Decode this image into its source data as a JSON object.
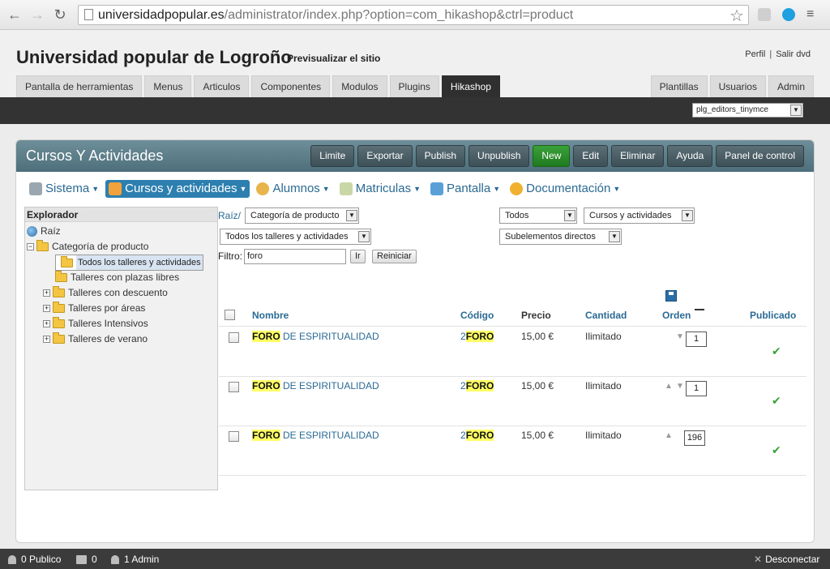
{
  "browser": {
    "url_host": "universidadpopular.es",
    "url_path": "/administrator/index.php?option=com_hikashop&ctrl=product"
  },
  "header": {
    "site_title": "Universidad popular de Logroño",
    "preview_link": "Previsualizar el sitio",
    "profile_link": "Perfil",
    "separator": "|",
    "logout_link": "Salir dvd"
  },
  "main_tabs": [
    {
      "label": "Pantalla de herramientas"
    },
    {
      "label": "Menus"
    },
    {
      "label": "Articulos"
    },
    {
      "label": "Componentes"
    },
    {
      "label": "Modulos"
    },
    {
      "label": "Plugins"
    },
    {
      "label": "Hikashop",
      "active": true
    }
  ],
  "right_tabs": [
    {
      "label": "Plantillas"
    },
    {
      "label": "Usuarios"
    },
    {
      "label": "Admin"
    }
  ],
  "editor_select": "plg_editors_tinymce",
  "panel": {
    "title": "Cursos Y Actividades",
    "toolbar": {
      "limite": "Limite",
      "exportar": "Exportar",
      "publish": "Publish",
      "unpublish": "Unpublish",
      "new": "New",
      "edit": "Edit",
      "eliminar": "Eliminar",
      "ayuda": "Ayuda",
      "panel_control": "Panel de control"
    }
  },
  "submenu": [
    {
      "label": "Sistema",
      "icon": "tools-icon"
    },
    {
      "label": "Cursos y actividades",
      "icon": "box-icon",
      "active": true
    },
    {
      "label": "Alumnos",
      "icon": "users-icon"
    },
    {
      "label": "Matriculas",
      "icon": "document-icon"
    },
    {
      "label": "Pantalla",
      "icon": "palette-icon"
    },
    {
      "label": "Documentación",
      "icon": "help-icon"
    }
  ],
  "explorer": {
    "title": "Explorador",
    "root": "Raíz",
    "category": "Categoría de producto",
    "children": [
      "Todos los talleres y actividades",
      "Talleres con plazas libres",
      "Talleres con descuento",
      "Talleres por áreas",
      "Talleres Intensivos",
      "Talleres de verano"
    ]
  },
  "filters": {
    "breadcrumb": "Raíz/",
    "category_select": "Categoría de producto",
    "workshop_select": "Todos los talleres y actividades",
    "status_select": "Todos",
    "type_select": "Cursos y actividades",
    "scope_select": "Subelementos directos",
    "filter_label": "Filtro:",
    "filter_value": "foro",
    "go_button": "Ir",
    "reset_button": "Reiniciar"
  },
  "table": {
    "headers": {
      "nombre": "Nombre",
      "codigo": "Código",
      "precio": "Precio",
      "cantidad": "Cantidad",
      "orden": "Orden",
      "publicado": "Publicado"
    },
    "rows": [
      {
        "name_hl": "FORO",
        "name_rest": " DE ESPIRITUALIDAD",
        "code_pre": "2",
        "code_hl": "FORO",
        "price": "15,00 €",
        "qty": "Ilimitado",
        "order": "1"
      },
      {
        "name_hl": "FORO",
        "name_rest": " DE ESPIRITUALIDAD",
        "code_pre": "2",
        "code_hl": "FORO",
        "price": "15,00 €",
        "qty": "Ilimitado",
        "order": "1"
      },
      {
        "name_hl": "FORO",
        "name_rest": " DE ESPIRITUALIDAD",
        "code_pre": "2",
        "code_hl": "FORO",
        "price": "15,00 €",
        "qty": "Ilimitado",
        "order": "196"
      }
    ]
  },
  "status_bar": {
    "public": "0 Publico",
    "messages": "0",
    "admin": "1 Admin",
    "disconnect": "Desconectar"
  }
}
